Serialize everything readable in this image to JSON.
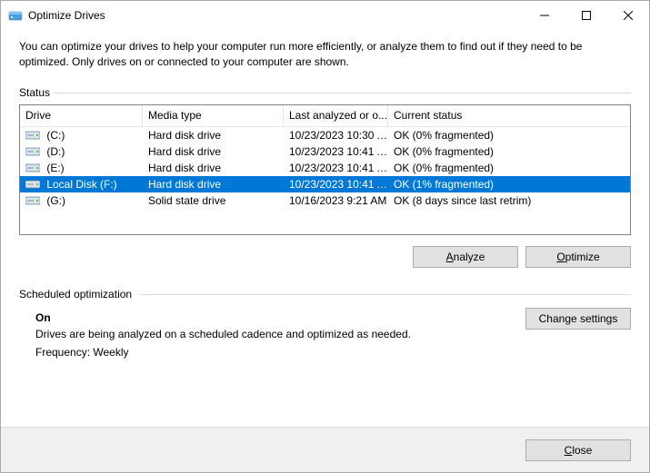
{
  "window": {
    "title": "Optimize Drives"
  },
  "description": "You can optimize your drives to help your computer run more efficiently, or analyze them to find out if they need to be optimized. Only drives on or connected to your computer are shown.",
  "status_label": "Status",
  "table": {
    "headers": {
      "drive": "Drive",
      "media": "Media type",
      "last": "Last analyzed or o...",
      "status": "Current status"
    },
    "rows": [
      {
        "drive": " (C:)",
        "media": "Hard disk drive",
        "last": "10/23/2023 10:30 A...",
        "status": "OK (0% fragmented)",
        "selected": false
      },
      {
        "drive": " (D:)",
        "media": "Hard disk drive",
        "last": "10/23/2023 10:41 A...",
        "status": "OK (0% fragmented)",
        "selected": false
      },
      {
        "drive": " (E:)",
        "media": "Hard disk drive",
        "last": "10/23/2023 10:41 A...",
        "status": "OK (0% fragmented)",
        "selected": false
      },
      {
        "drive": " Local Disk (F:)",
        "media": "Hard disk drive",
        "last": "10/23/2023 10:41 A...",
        "status": "OK (1% fragmented)",
        "selected": true
      },
      {
        "drive": " (G:)",
        "media": "Solid state drive",
        "last": "10/16/2023 9:21 AM",
        "status": "OK (8 days since last retrim)",
        "selected": false
      }
    ]
  },
  "buttons": {
    "analyze": "Analyze",
    "analyze_mnemonic": "A",
    "optimize": "Optimize",
    "optimize_mnemonic": "O",
    "change": "Change settings",
    "close": "Close",
    "close_mnemonic": "C"
  },
  "sched": {
    "label": "Scheduled optimization",
    "on": "On",
    "desc": "Drives are being analyzed on a scheduled cadence and optimized as needed.",
    "freq": "Frequency: Weekly"
  }
}
